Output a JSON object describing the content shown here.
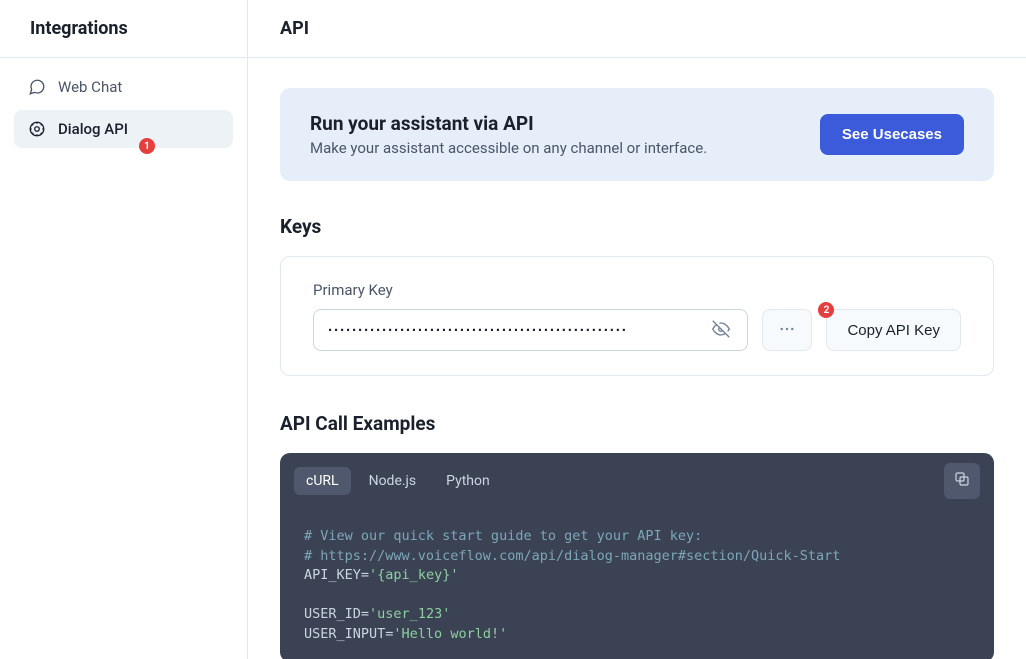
{
  "sidebar": {
    "title": "Integrations",
    "items": [
      {
        "label": "Web Chat"
      },
      {
        "label": "Dialog API",
        "badge": "1"
      }
    ]
  },
  "main": {
    "title": "API",
    "callout": {
      "heading": "Run your assistant via API",
      "subtext": "Make your assistant accessible on any channel or interface.",
      "button": "See Usecases"
    },
    "keys": {
      "heading": "Keys",
      "primary_label": "Primary Key",
      "masked_value": "··················································",
      "copy_label": "Copy API Key",
      "badge": "2"
    },
    "examples": {
      "heading": "API Call Examples",
      "tabs": [
        "cURL",
        "Node.js",
        "Python"
      ],
      "active_tab": 0,
      "code": {
        "comment1": "# View our quick start guide to get your API key:",
        "comment2": "# https://www.voiceflow.com/api/dialog-manager#section/Quick-Start",
        "line1_var": "API_KEY",
        "line1_val": "'{api_key}'",
        "line2_var": "USER_ID",
        "line2_val": "'user_123'",
        "line3_var": "USER_INPUT",
        "line3_val": "'Hello world!'"
      }
    }
  }
}
